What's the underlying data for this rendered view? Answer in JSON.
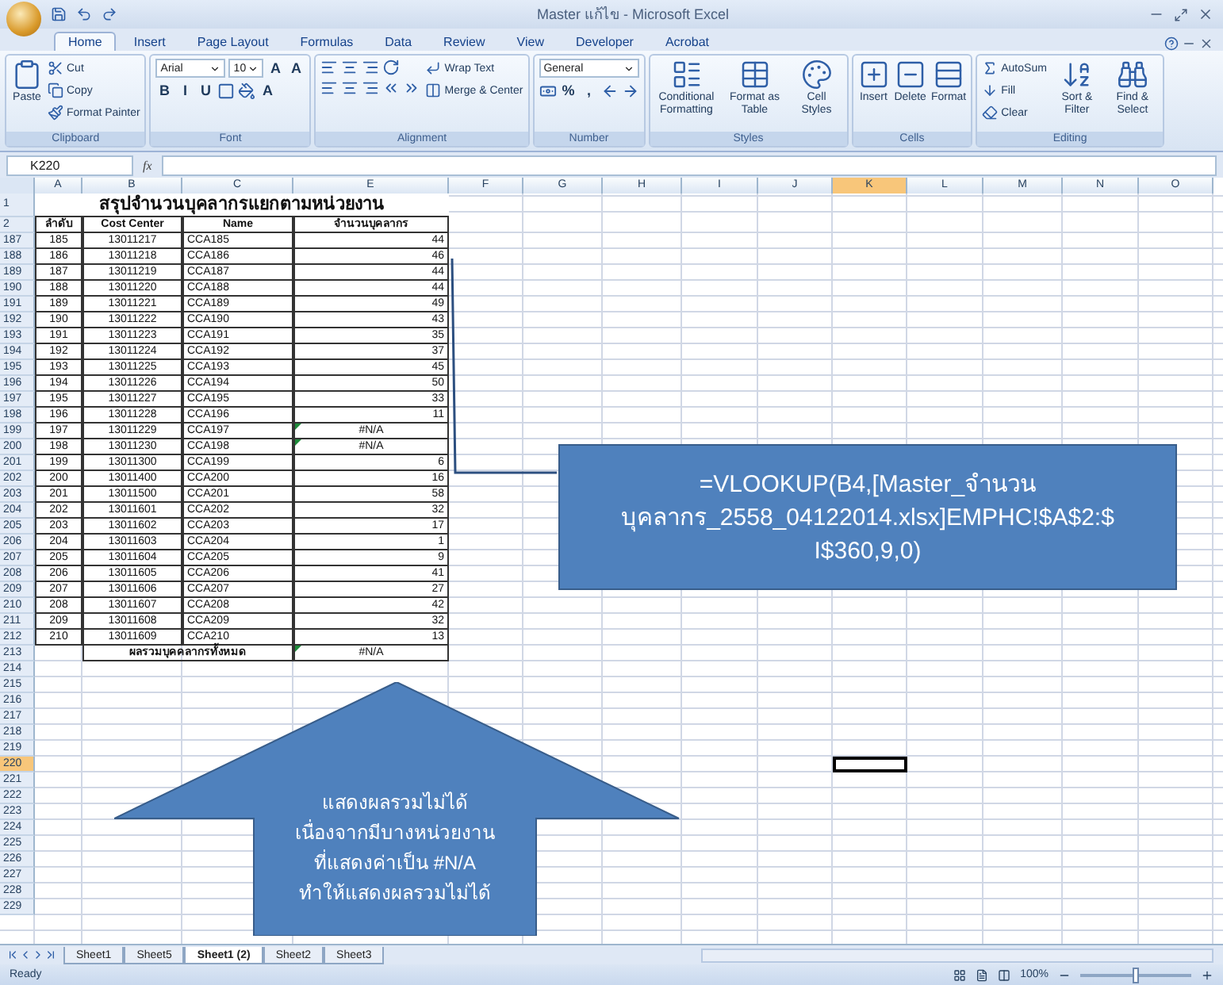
{
  "window": {
    "title": "Master แก้ไข - Microsoft Excel"
  },
  "ribbon_tabs": [
    {
      "label": "Home",
      "selected": true
    },
    {
      "label": "Insert",
      "selected": false
    },
    {
      "label": "Page Layout",
      "selected": false
    },
    {
      "label": "Formulas",
      "selected": false
    },
    {
      "label": "Data",
      "selected": false
    },
    {
      "label": "Review",
      "selected": false
    },
    {
      "label": "View",
      "selected": false
    },
    {
      "label": "Developer",
      "selected": false
    },
    {
      "label": "Acrobat",
      "selected": false
    }
  ],
  "ribbon_groups": [
    {
      "label": "Clipboard",
      "columns": [
        [
          {
            "kind": "large",
            "label": "Paste"
          }
        ],
        [
          {
            "kind": "small",
            "label": "Cut"
          },
          {
            "kind": "small",
            "label": "Copy"
          },
          {
            "kind": "small",
            "label": "Format Painter"
          }
        ]
      ]
    },
    {
      "label": "Font",
      "columns": [
        [
          {
            "kind": "row",
            "items": [
              {
                "kind": "select",
                "value": "Arial"
              },
              {
                "kind": "select",
                "value": "10"
              },
              {
                "kind": "glyph",
                "text": "A"
              },
              {
                "kind": "glyph",
                "text": "A"
              }
            ]
          },
          {
            "kind": "row",
            "items": [
              {
                "kind": "glyph",
                "text": "B"
              },
              {
                "kind": "glyph",
                "text": "I"
              },
              {
                "kind": "glyph",
                "text": "U"
              },
              {
                "kind": "icon"
              },
              {
                "kind": "icon"
              },
              {
                "kind": "glyph",
                "text": "A"
              }
            ]
          }
        ]
      ]
    },
    {
      "label": "Alignment",
      "columns": [
        [
          {
            "kind": "row",
            "items": [
              {
                "kind": "icon"
              },
              {
                "kind": "icon"
              },
              {
                "kind": "icon"
              },
              {
                "kind": "icon"
              }
            ]
          },
          {
            "kind": "row",
            "items": [
              {
                "kind": "icon"
              },
              {
                "kind": "icon"
              },
              {
                "kind": "icon"
              },
              {
                "kind": "icon"
              },
              {
                "kind": "icon"
              }
            ]
          }
        ],
        [
          {
            "kind": "small",
            "label": "Wrap Text"
          },
          {
            "kind": "small",
            "label": "Merge & Center"
          }
        ]
      ]
    },
    {
      "label": "Number",
      "columns": [
        [
          {
            "kind": "select",
            "value": "General"
          },
          {
            "kind": "row",
            "items": [
              {
                "kind": "icon"
              },
              {
                "kind": "glyph",
                "text": "%"
              },
              {
                "kind": "glyph",
                "text": ","
              },
              {
                "kind": "icon"
              },
              {
                "kind": "icon"
              }
            ]
          }
        ]
      ]
    },
    {
      "label": "Styles",
      "columns": [
        [
          {
            "kind": "large",
            "label": "Conditional Formatting"
          }
        ],
        [
          {
            "kind": "large",
            "label": "Format as Table"
          }
        ],
        [
          {
            "kind": "large",
            "label": "Cell Styles"
          }
        ]
      ]
    },
    {
      "label": "Cells",
      "columns": [
        [
          {
            "kind": "large",
            "label": "Insert"
          }
        ],
        [
          {
            "kind": "large",
            "label": "Delete"
          }
        ],
        [
          {
            "kind": "large",
            "label": "Format"
          }
        ]
      ]
    },
    {
      "label": "Editing",
      "columns": [
        [
          {
            "kind": "small",
            "label": "AutoSum"
          },
          {
            "kind": "small",
            "label": "Fill"
          },
          {
            "kind": "small",
            "label": "Clear"
          }
        ],
        [
          {
            "kind": "large",
            "label": "Sort & Filter"
          }
        ],
        [
          {
            "kind": "large",
            "label": "Find & Select"
          }
        ]
      ]
    }
  ],
  "formula_bar": {
    "name_box": "K220",
    "fx": "fx"
  },
  "columns": [
    {
      "label": "A",
      "selected": false
    },
    {
      "label": "B",
      "selected": false
    },
    {
      "label": "C",
      "selected": false
    },
    {
      "label": "E",
      "selected": false
    },
    {
      "label": "F",
      "selected": false
    },
    {
      "label": "G",
      "selected": false
    },
    {
      "label": "H",
      "selected": false
    },
    {
      "label": "I",
      "selected": false
    },
    {
      "label": "J",
      "selected": false
    },
    {
      "label": "K",
      "selected": true
    },
    {
      "label": "L",
      "selected": false
    },
    {
      "label": "M",
      "selected": false
    },
    {
      "label": "N",
      "selected": false
    },
    {
      "label": "O",
      "selected": false
    }
  ],
  "rows": [
    {
      "header": "1",
      "selected": false,
      "kind": "title",
      "text": "สรุปจำนวนบุคลากรแยกตามหน่วยงาน"
    },
    {
      "header": "2",
      "selected": false,
      "kind": "head",
      "cells": [
        "ลำดับ",
        "Cost Center",
        "Name",
        "จำนวนบุคลากร"
      ]
    },
    {
      "header": "187",
      "selected": false,
      "kind": "data",
      "error": false,
      "cells": [
        "185",
        "13011217",
        "CCA185",
        "44"
      ]
    },
    {
      "header": "188",
      "selected": false,
      "kind": "data",
      "error": false,
      "cells": [
        "186",
        "13011218",
        "CCA186",
        "46"
      ]
    },
    {
      "header": "189",
      "selected": false,
      "kind": "data",
      "error": false,
      "cells": [
        "187",
        "13011219",
        "CCA187",
        "44"
      ]
    },
    {
      "header": "190",
      "selected": false,
      "kind": "data",
      "error": false,
      "cells": [
        "188",
        "13011220",
        "CCA188",
        "44"
      ]
    },
    {
      "header": "191",
      "selected": false,
      "kind": "data",
      "error": false,
      "cells": [
        "189",
        "13011221",
        "CCA189",
        "49"
      ]
    },
    {
      "header": "192",
      "selected": false,
      "kind": "data",
      "error": false,
      "cells": [
        "190",
        "13011222",
        "CCA190",
        "43"
      ]
    },
    {
      "header": "193",
      "selected": false,
      "kind": "data",
      "error": false,
      "cells": [
        "191",
        "13011223",
        "CCA191",
        "35"
      ]
    },
    {
      "header": "194",
      "selected": false,
      "kind": "data",
      "error": false,
      "cells": [
        "192",
        "13011224",
        "CCA192",
        "37"
      ]
    },
    {
      "header": "195",
      "selected": false,
      "kind": "data",
      "error": false,
      "cells": [
        "193",
        "13011225",
        "CCA193",
        "45"
      ]
    },
    {
      "header": "196",
      "selected": false,
      "kind": "data",
      "error": false,
      "cells": [
        "194",
        "13011226",
        "CCA194",
        "50"
      ]
    },
    {
      "header": "197",
      "selected": false,
      "kind": "data",
      "error": false,
      "cells": [
        "195",
        "13011227",
        "CCA195",
        "33"
      ]
    },
    {
      "header": "198",
      "selected": false,
      "kind": "data",
      "error": false,
      "cells": [
        "196",
        "13011228",
        "CCA196",
        "11"
      ]
    },
    {
      "header": "199",
      "selected": false,
      "kind": "data",
      "error": true,
      "cells": [
        "197",
        "13011229",
        "CCA197",
        "#N/A"
      ]
    },
    {
      "header": "200",
      "selected": false,
      "kind": "data",
      "error": true,
      "cells": [
        "198",
        "13011230",
        "CCA198",
        "#N/A"
      ]
    },
    {
      "header": "201",
      "selected": false,
      "kind": "data",
      "error": false,
      "cells": [
        "199",
        "13011300",
        "CCA199",
        "6"
      ]
    },
    {
      "header": "202",
      "selected": false,
      "kind": "data",
      "error": false,
      "cells": [
        "200",
        "13011400",
        "CCA200",
        "16"
      ]
    },
    {
      "header": "203",
      "selected": false,
      "kind": "data",
      "error": false,
      "cells": [
        "201",
        "13011500",
        "CCA201",
        "58"
      ]
    },
    {
      "header": "204",
      "selected": false,
      "kind": "data",
      "error": false,
      "cells": [
        "202",
        "13011601",
        "CCA202",
        "32"
      ]
    },
    {
      "header": "205",
      "selected": false,
      "kind": "data",
      "error": false,
      "cells": [
        "203",
        "13011602",
        "CCA203",
        "17"
      ]
    },
    {
      "header": "206",
      "selected": false,
      "kind": "data",
      "error": false,
      "cells": [
        "204",
        "13011603",
        "CCA204",
        "1"
      ]
    },
    {
      "header": "207",
      "selected": false,
      "kind": "data",
      "error": false,
      "cells": [
        "205",
        "13011604",
        "CCA205",
        "9"
      ]
    },
    {
      "header": "208",
      "selected": false,
      "kind": "data",
      "error": false,
      "cells": [
        "206",
        "13011605",
        "CCA206",
        "41"
      ]
    },
    {
      "header": "209",
      "selected": false,
      "kind": "data",
      "error": false,
      "cells": [
        "207",
        "13011606",
        "CCA207",
        "27"
      ]
    },
    {
      "header": "210",
      "selected": false,
      "kind": "data",
      "error": false,
      "cells": [
        "208",
        "13011607",
        "CCA208",
        "42"
      ]
    },
    {
      "header": "211",
      "selected": false,
      "kind": "data",
      "error": false,
      "cells": [
        "209",
        "13011608",
        "CCA209",
        "32"
      ]
    },
    {
      "header": "212",
      "selected": false,
      "kind": "data",
      "error": false,
      "cells": [
        "210",
        "13011609",
        "CCA210",
        "13"
      ]
    },
    {
      "header": "213",
      "selected": false,
      "kind": "total",
      "error": true,
      "label": "ผลรวมบุคคลากรทั้งหมด",
      "value": "#N/A"
    },
    {
      "header": "214",
      "selected": false,
      "kind": "empty"
    },
    {
      "header": "215",
      "selected": false,
      "kind": "empty"
    },
    {
      "header": "216",
      "selected": false,
      "kind": "empty"
    },
    {
      "header": "217",
      "selected": false,
      "kind": "empty"
    },
    {
      "header": "218",
      "selected": false,
      "kind": "empty"
    },
    {
      "header": "219",
      "selected": false,
      "kind": "empty"
    },
    {
      "header": "220",
      "selected": true,
      "kind": "empty"
    },
    {
      "header": "221",
      "selected": false,
      "kind": "empty"
    },
    {
      "header": "222",
      "selected": false,
      "kind": "empty"
    },
    {
      "header": "223",
      "selected": false,
      "kind": "empty"
    },
    {
      "header": "224",
      "selected": false,
      "kind": "empty"
    },
    {
      "header": "225",
      "selected": false,
      "kind": "empty"
    },
    {
      "header": "226",
      "selected": false,
      "kind": "empty"
    },
    {
      "header": "227",
      "selected": false,
      "kind": "empty"
    },
    {
      "header": "228",
      "selected": false,
      "kind": "empty"
    },
    {
      "header": "229",
      "selected": false,
      "kind": "empty"
    }
  ],
  "callouts": [
    {
      "kind": "box",
      "text": "=VLOOKUP(B4,[Master_จำนวน\nบุคลากร_2558_04122014.xlsx]EMPHC!$A$2:$\nI$360,9,0)"
    },
    {
      "kind": "arrow",
      "text": "แสดงผลรวมไม่ได้\nเนื่องจากมีบางหน่วยงาน\nที่แสดงค่าเป็น #N/A\nทำให้แสดงผลรวมไม่ได้"
    }
  ],
  "sheet_tabs": [
    {
      "label": "Sheet1",
      "selected": false
    },
    {
      "label": "Sheet5",
      "selected": false
    },
    {
      "label": "Sheet1 (2)",
      "selected": true
    },
    {
      "label": "Sheet2",
      "selected": false
    },
    {
      "label": "Sheet3",
      "selected": false
    }
  ],
  "status_bar": {
    "status": "Ready",
    "zoom": "100%",
    "zoom_slider": {
      "level": 0.5
    }
  }
}
